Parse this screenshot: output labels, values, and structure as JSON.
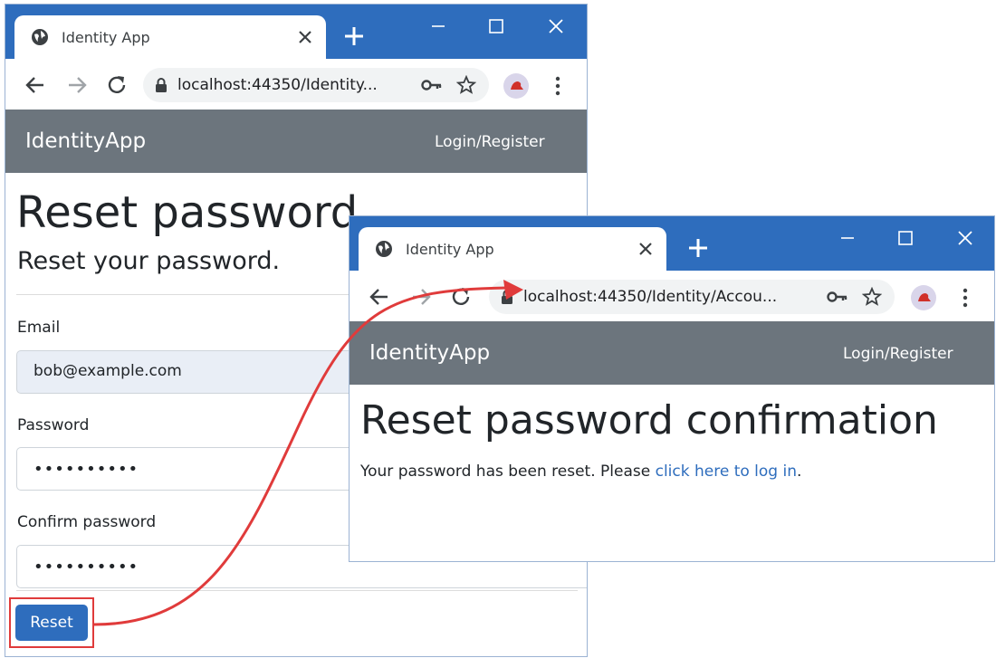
{
  "window1": {
    "tab_title": "Identity App",
    "url": "localhost:44350/Identity...",
    "brand": "IdentityApp",
    "login_link": "Login/Register",
    "page_title": "Reset password",
    "subtitle": "Reset your password.",
    "email_label": "Email",
    "email_value": "bob@example.com",
    "password_label": "Password",
    "password_value": "••••••••••",
    "confirm_label": "Confirm password",
    "confirm_value": "••••••••••",
    "reset_button": "Reset"
  },
  "window2": {
    "tab_title": "Identity App",
    "url": "localhost:44350/Identity/Accou...",
    "brand": "IdentityApp",
    "login_link": "Login/Register",
    "page_title": "Reset password confirmation",
    "message_prefix": "Your password has been reset. Please ",
    "message_link": "click here to log in",
    "message_suffix": "."
  },
  "colors": {
    "titlebar": "#2e6dbd",
    "navbar": "#6c757d",
    "link": "#2e6dbd",
    "arrow": "#e03b3b"
  },
  "icons": [
    "globe-icon",
    "close-icon",
    "plus-icon",
    "minimize-icon",
    "maximize-icon",
    "back-icon",
    "forward-icon",
    "reload-icon",
    "lock-icon",
    "key-icon",
    "star-icon",
    "avatar",
    "kebab-menu-icon"
  ]
}
